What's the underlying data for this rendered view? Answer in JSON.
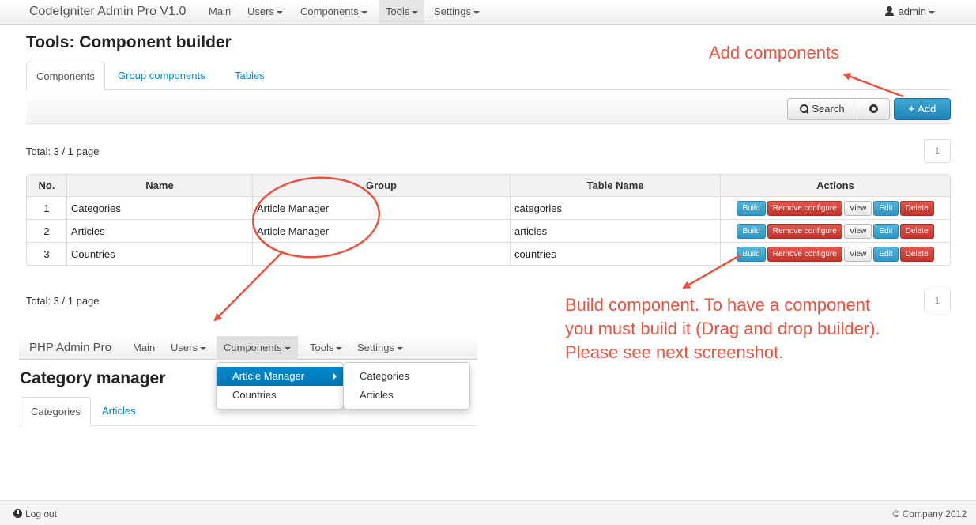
{
  "navbar": {
    "brand": "CodeIgniter Admin Pro V1.0",
    "items": [
      {
        "label": "Main"
      },
      {
        "label": "Users"
      },
      {
        "label": "Components"
      },
      {
        "label": "Tools"
      },
      {
        "label": "Settings"
      }
    ],
    "user": "admin"
  },
  "page": {
    "title": "Tools: Component builder"
  },
  "tabs": [
    {
      "label": "Components"
    },
    {
      "label": "Group components"
    },
    {
      "label": "Tables"
    }
  ],
  "toolbar": {
    "search_label": "Search",
    "add_label": "Add"
  },
  "summary": {
    "total_top": "Total: 3 / 1 page",
    "total_bottom": "Total: 3 / 1 page",
    "page_number": "1"
  },
  "table": {
    "headers": [
      "No.",
      "Name",
      "Group",
      "Table Name",
      "Actions"
    ],
    "rows": [
      {
        "no": "1",
        "name": "Categories",
        "group": "Article Manager",
        "table": "categories"
      },
      {
        "no": "2",
        "name": "Articles",
        "group": "Article Manager",
        "table": "articles"
      },
      {
        "no": "3",
        "name": "Countries",
        "group": "",
        "table": "countries"
      }
    ],
    "actions": {
      "build": "Build",
      "remove": "Remove configure",
      "view": "View",
      "edit": "Edit",
      "delete": "Delete"
    }
  },
  "annotations": {
    "add": "Add components",
    "build_line1": "Build component. To have a component",
    "build_line2": "you must build it (Drag and drop builder).",
    "build_line3": "Please see next screenshot.",
    "color": "#e8533f"
  },
  "inset": {
    "brand": "PHP Admin Pro",
    "items": [
      {
        "label": "Main"
      },
      {
        "label": "Users"
      },
      {
        "label": "Components"
      },
      {
        "label": "Tools"
      },
      {
        "label": "Settings"
      }
    ],
    "title": "Category manager",
    "tabs": [
      {
        "label": "Categories"
      },
      {
        "label": "Articles"
      }
    ],
    "dropdown": [
      {
        "label": "Article Manager"
      },
      {
        "label": "Countries"
      }
    ],
    "submenu": [
      {
        "label": "Categories"
      },
      {
        "label": "Articles"
      }
    ]
  },
  "footer": {
    "logout": "Log out",
    "copyright": "© Company 2012"
  }
}
